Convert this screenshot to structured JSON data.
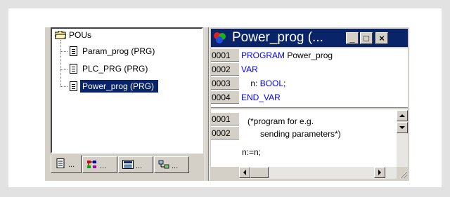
{
  "tree": {
    "root_label": "POUs",
    "items": [
      {
        "label": "Param_prog (PRG)",
        "selected": false
      },
      {
        "label": "PLC_PRG (PRG)",
        "selected": false
      },
      {
        "label": "Power_prog (PRG)",
        "selected": true
      }
    ]
  },
  "tabs": [
    {
      "icon": "pou-tab-icon",
      "label": "..."
    },
    {
      "icon": "datatypes-tab-icon",
      "label": "..."
    },
    {
      "icon": "visualizations-tab-icon",
      "label": "..."
    },
    {
      "icon": "resources-tab-icon",
      "label": "..."
    }
  ],
  "editor": {
    "title": "Power_prog (...",
    "window_buttons": {
      "minimize": "_",
      "maximize": "□",
      "close": "×"
    },
    "declaration": [
      {
        "line": "0001",
        "keyword": "PROGRAM",
        "text": " Power_prog"
      },
      {
        "line": "0002",
        "keyword": "VAR",
        "text": ""
      },
      {
        "line": "0003",
        "keyword": "",
        "text": "    n: ",
        "type": "BOOL",
        "tail": ";"
      },
      {
        "line": "0004",
        "keyword": "END_VAR",
        "text": ""
      }
    ],
    "body": {
      "line_numbers": [
        "0001",
        "0002"
      ],
      "comment_line_1": "(*program for e.g.",
      "comment_line_2": "sending parameters*)",
      "code_line": "n:=n;"
    }
  },
  "colors": {
    "selection": "#0a246a",
    "keyword": "#0000ff",
    "face": "#d4d0c8"
  }
}
